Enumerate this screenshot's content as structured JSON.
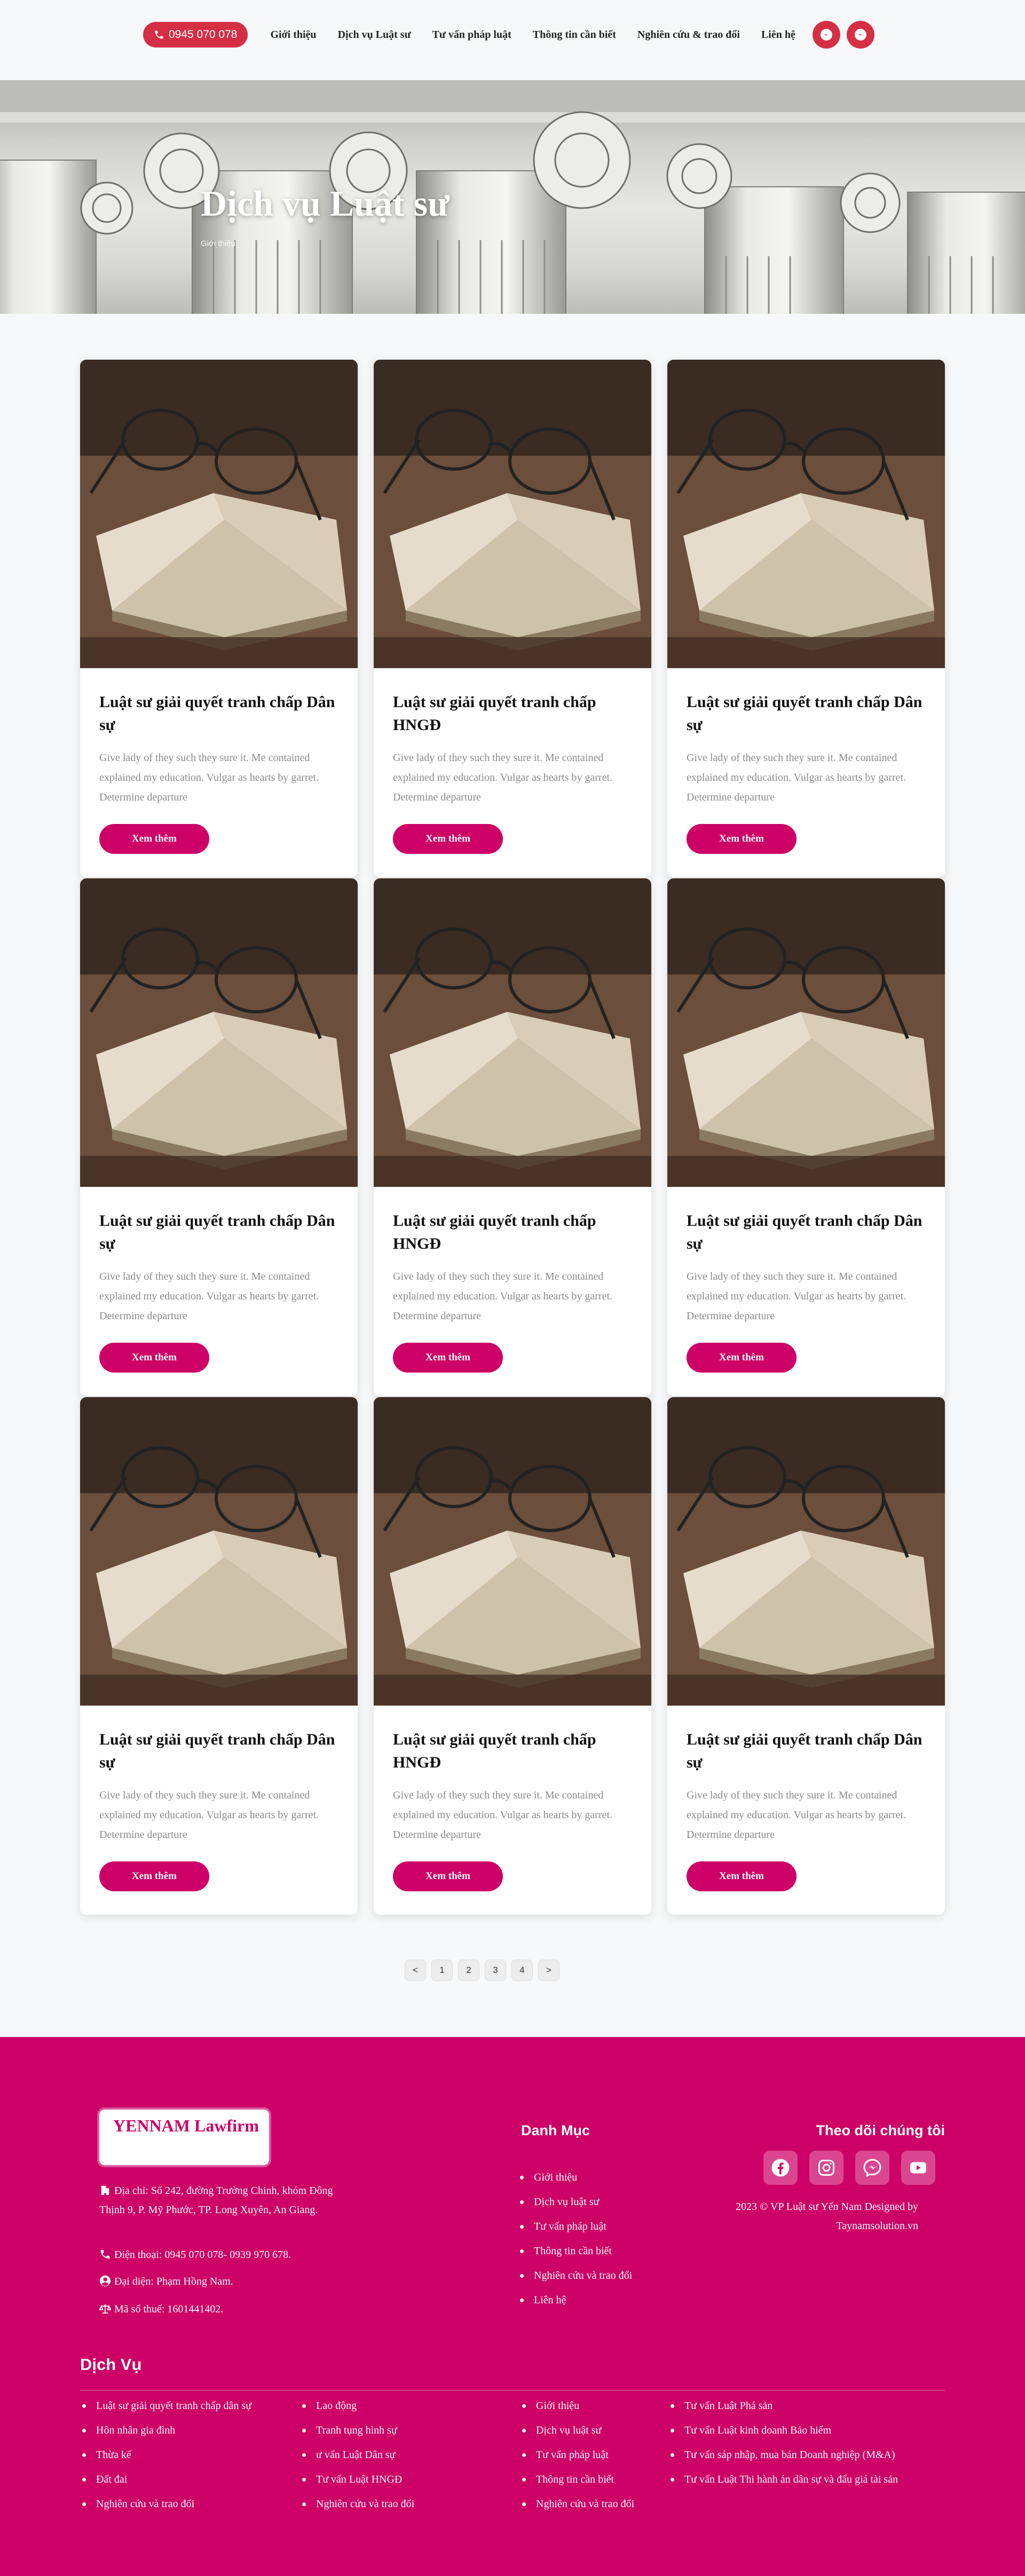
{
  "header": {
    "phone": "0945 070 078",
    "nav": [
      "Giới thiệu",
      "Dịch vụ Luật sư",
      "Tư vấn pháp luật",
      "Thông tin cần biết",
      "Nghiên cứu & trao đổi",
      "Liên hệ"
    ],
    "icons": [
      "messenger-icon",
      "messenger-icon"
    ]
  },
  "hero": {
    "title": "Dịch vụ Luật sư",
    "breadcrumb": "Giới thiệu"
  },
  "cards": [
    {
      "title": "Luật sư giải quyết tranh chấp Dân sự",
      "desc": "Give lady of they such they sure it. Me contained explained my education. Vulgar as hearts by garret. Determine departure",
      "button": "Xem thêm"
    },
    {
      "title": "Luật sư giải quyết tranh chấp HNGĐ",
      "desc": "Give lady of they such they sure it. Me contained explained my education. Vulgar as hearts by garret. Determine departure",
      "button": "Xem thêm"
    },
    {
      "title": "Luật sư giải quyết tranh chấp Dân sự",
      "desc": "Give lady of they such they sure it. Me contained explained my education. Vulgar as hearts by garret. Determine departure",
      "button": "Xem thêm"
    },
    {
      "title": "Luật sư giải quyết tranh chấp Dân sự",
      "desc": "Give lady of they such they sure it. Me contained explained my education. Vulgar as hearts by garret. Determine departure",
      "button": "Xem thêm"
    },
    {
      "title": "Luật sư giải quyết tranh chấp HNGĐ",
      "desc": "Give lady of they such they sure it. Me contained explained my education. Vulgar as hearts by garret. Determine departure",
      "button": "Xem thêm"
    },
    {
      "title": "Luật sư giải quyết tranh chấp Dân sự",
      "desc": "Give lady of they such they sure it. Me contained explained my education. Vulgar as hearts by garret. Determine departure",
      "button": "Xem thêm"
    },
    {
      "title": "Luật sư giải quyết tranh chấp Dân sự",
      "desc": "Give lady of they such they sure it. Me contained explained my education. Vulgar as hearts by garret. Determine departure",
      "button": "Xem thêm"
    },
    {
      "title": "Luật sư giải quyết tranh chấp HNGĐ",
      "desc": "Give lady of they such they sure it. Me contained explained my education. Vulgar as hearts by garret. Determine departure",
      "button": "Xem thêm"
    },
    {
      "title": "Luật sư giải quyết tranh chấp Dân sự",
      "desc": "Give lady of they such they sure it. Me contained explained my education. Vulgar as hearts by garret. Determine departure",
      "button": "Xem thêm"
    }
  ],
  "pagination": [
    "<",
    "1",
    "2",
    "3",
    "4",
    ">"
  ],
  "footer": {
    "logo": "YENNAM Lawfirm",
    "address": "Địa chỉ: Số 242, đường Trường Chinh, khóm Đông Thịnh 9, P. Mỹ Phước, TP. Long Xuyên, An Giang.",
    "phone": "Điện thoại: 0945 070 078- 0939 970 678.",
    "representative": "Đại diện: Phạm Hồng Nam.",
    "tax": "Mã số thuế: 1601441402.",
    "menu_heading": "Danh Mục",
    "menu": [
      "Giới thiệu",
      "Dịch vụ luật sư",
      "Tư vấn pháp luật",
      "Thông tin cần biết",
      "Nghiên cứu và trao đổi",
      "Liên hệ"
    ],
    "follow_heading": "Theo dõi chúng tôi",
    "social_icons": [
      "facebook-icon",
      "instagram-icon",
      "messenger-icon",
      "youtube-icon"
    ],
    "copyright": "2023 © VP Luật sư Yến Nam Designed by Taynamsolution.vn",
    "services_heading": "Dịch Vụ",
    "services_col1": [
      "Luật sư giải quyết tranh chấp dân sự",
      "Hôn nhân gia đình",
      "Thừa kế",
      "Đất đai",
      "Nghiên cứu và trao đổi"
    ],
    "services_col2": [
      "Lao động",
      "Tranh tụng hình sự",
      "ư vấn Luật Dân sự",
      "Tư vấn Luật HNGĐ",
      "Nghiên cứu và trao đổi"
    ],
    "services_col3": [
      "Giới thiệu",
      "Dịch vụ luật sư",
      "Tư vấn pháp luật",
      "Thông tin cần biết",
      "Nghiên cứu và trao đổi"
    ],
    "services_col4": [
      "Tư vấn Luật Phá sản",
      "Tư vấn Luật kinh doanh Bảo hiểm",
      "Tư vấn sáp nhập, mua bán Doanh nghiệp (M&A)",
      "Tư vấn Luật Thi hành án dân sự và đấu giá tài sản"
    ]
  },
  "colors": {
    "accent": "#cc0066",
    "phone_button": "#d42f45"
  }
}
